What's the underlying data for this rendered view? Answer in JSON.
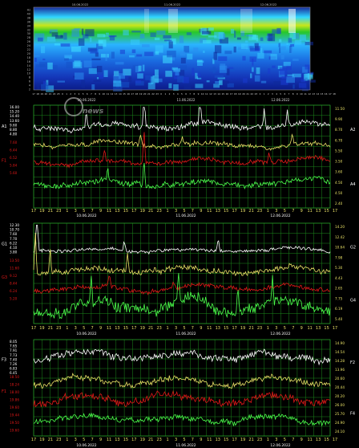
{
  "colors": {
    "background": "#000000",
    "grid": "#1c8a1c",
    "white_series": "#ffffff",
    "yellow_series": "#e8e066",
    "red_series": "#e01818",
    "green_series": "#4cff4c",
    "left_labels": "#ffffff",
    "right_labels": "#e8e066",
    "red_labels": "#e01818"
  },
  "spectrogram": {
    "top_labels": [
      "10.06.2022",
      "11.06.2022",
      "12.06.2022"
    ],
    "freq_ticks": [
      "Hz",
      "40",
      "38",
      "36",
      "34",
      "32",
      "30",
      "28",
      "26",
      "24",
      "22",
      "20",
      "18",
      "16",
      "14",
      "12",
      "10",
      "8",
      "6",
      "4",
      "2"
    ],
    "dates": [
      "10.06.2022",
      "11.06.2022",
      "12.06.2022"
    ]
  },
  "x_hours": [
    "17",
    "19",
    "21",
    "23",
    "1",
    "3",
    "5",
    "7",
    "9",
    "11",
    "13",
    "15",
    "17",
    "19",
    "21",
    "23",
    "1",
    "3",
    "5",
    "7",
    "9",
    "11",
    "13",
    "15",
    "17",
    "19",
    "21",
    "23",
    "1",
    "3",
    "5",
    "7",
    "9",
    "11",
    "13",
    "15",
    "17"
  ],
  "x_dates": [
    "10.06.2022",
    "11.06.2022",
    "12.06.2022"
  ],
  "watermark": "news",
  "chart_data": [
    {
      "type": "line",
      "name": "panel-1",
      "left_axis_label_a": "A1",
      "left_axis_label_b": "F1",
      "right_axis_label_a": "A2",
      "right_axis_label_b": "A4",
      "left_ticks_white": [
        "16.00",
        "15.20",
        "14.40",
        "13.60",
        "9.60",
        "8.80",
        "4.80"
      ],
      "left_ticks_red": [
        "7.60",
        "6.44",
        "6.52",
        "5.84",
        "5.60"
      ],
      "right_ticks": [
        "11.50",
        "9.90",
        "8.70",
        "6.70",
        "5.50",
        "3.50",
        "3.60",
        "4.50",
        "4.50",
        "2.40"
      ],
      "series": [
        {
          "color": "white",
          "level": 0.2,
          "jitter": 0.05,
          "spikes": [
            [
              3.2,
              0.18
            ],
            [
              6.7,
              0.45
            ],
            [
              10.1,
              0.25
            ],
            [
              14.0,
              0.2
            ],
            [
              15.4,
              0.15
            ]
          ]
        },
        {
          "color": "yellow",
          "level": 0.38,
          "jitter": 0.04,
          "spikes": [
            [
              6.5,
              0.12
            ],
            [
              9.0,
              0.08
            ],
            [
              15.7,
              0.1
            ]
          ]
        },
        {
          "color": "red",
          "level": 0.55,
          "jitter": 0.04,
          "spikes": [
            [
              6.7,
              0.35
            ],
            [
              4.3,
              0.1
            ],
            [
              14.3,
              0.1
            ]
          ]
        },
        {
          "color": "green",
          "level": 0.76,
          "jitter": 0.05,
          "spikes": [
            [
              6.7,
              0.3
            ],
            [
              4.5,
              0.1
            ]
          ]
        }
      ]
    },
    {
      "type": "line",
      "name": "panel-2",
      "left_axis_label_a": "G1",
      "left_axis_label_b": "G3",
      "right_axis_label_a": "G2",
      "right_axis_label_b": "G4",
      "left_ticks_white": [
        "12.30",
        "10.70",
        "7.60",
        "7.70",
        "6.22",
        "4.10",
        "3.80"
      ],
      "left_ticks_red": [
        "13.50",
        "11.60",
        "9.12",
        "8.44",
        "6.24",
        "5.20"
      ],
      "right_ticks": [
        "14.20",
        "12.42",
        "10.64",
        "7.98",
        "5.30",
        "4.43",
        "2.65",
        "7.75",
        "6.19",
        "5.40"
      ],
      "series": [
        {
          "color": "white",
          "level": 0.27,
          "jitter": 0.03,
          "spikes": [
            [
              0.2,
              0.55
            ],
            [
              5.5,
              0.1
            ],
            [
              11.2,
              0.12
            ]
          ]
        },
        {
          "color": "yellow",
          "level": 0.47,
          "jitter": 0.05,
          "spikes": [
            [
              0.1,
              0.45
            ],
            [
              1.0,
              0.25
            ],
            [
              5.7,
              0.2
            ]
          ]
        },
        {
          "color": "red",
          "level": 0.65,
          "jitter": 0.04,
          "spikes": [
            [
              4.6,
              0.12
            ],
            [
              8.5,
              0.08
            ]
          ]
        },
        {
          "color": "green",
          "level": 0.83,
          "jitter": 0.1,
          "spikes": [
            [
              3.5,
              0.3
            ],
            [
              8.8,
              0.3
            ],
            [
              12.4,
              0.25
            ],
            [
              14.5,
              0.25
            ]
          ]
        }
      ]
    },
    {
      "type": "line",
      "name": "panel-3",
      "left_axis_label_a": "F3",
      "left_axis_label_b": "F1",
      "right_axis_label_a": "F2",
      "right_axis_label_b": "F4",
      "left_ticks_white": [
        "8.05",
        "7.65",
        "7.91",
        "7.73",
        "7.40",
        "7.26",
        "6.83",
        "6.45"
      ],
      "left_ticks_red": [
        "18.50",
        "18.24",
        "18.00",
        "19.86",
        "19.60",
        "19.44",
        "19.50",
        "19.60"
      ],
      "right_ticks": [
        "14.90",
        "14.54",
        "14.28",
        "13.96",
        "20.60",
        "20.44",
        "20.20",
        "26.00",
        "25.70",
        "24.90",
        "24.10"
      ],
      "series": [
        {
          "color": "white",
          "level": 0.18,
          "jitter": 0.07,
          "spikes": []
        },
        {
          "color": "yellow",
          "level": 0.43,
          "jitter": 0.06,
          "spikes": []
        },
        {
          "color": "red",
          "level": 0.62,
          "jitter": 0.07,
          "spikes": []
        },
        {
          "color": "green",
          "level": 0.83,
          "jitter": 0.05,
          "spikes": []
        }
      ]
    }
  ]
}
